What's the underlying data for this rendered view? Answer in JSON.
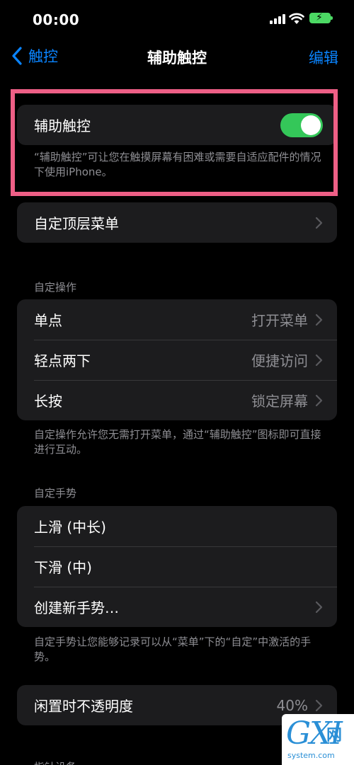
{
  "status_bar": {
    "time": "00:00"
  },
  "nav": {
    "back_label": "触控",
    "title": "辅助触控",
    "edit_label": "编辑"
  },
  "assistive_touch": {
    "label": "辅助触控",
    "enabled": true,
    "description": "“辅助触控”可让您在触摸屏幕有困难或需要自适应配件的情况下使用iPhone。"
  },
  "top_menu": {
    "label": "自定顶层菜单"
  },
  "custom_actions": {
    "header": "自定操作",
    "items": [
      {
        "label": "单点",
        "value": "打开菜单"
      },
      {
        "label": "轻点两下",
        "value": "便捷访问"
      },
      {
        "label": "长按",
        "value": "锁定屏幕"
      }
    ],
    "footer": "自定操作允许您无需打开菜单，通过“辅助触控”图标即可直接进行互动。"
  },
  "custom_gestures": {
    "header": "自定手势",
    "items": [
      {
        "label": "上滑 (中长)"
      },
      {
        "label": "下滑 (中)"
      },
      {
        "label": "创建新手势…"
      }
    ],
    "footer": "自定手势让您能够记录可以从“菜单”下的“自定”中激活的手势。"
  },
  "idle_opacity": {
    "label": "闲置时不透明度",
    "value": "40%"
  },
  "next_section_header": "指针设备",
  "watermark": {
    "logo": "GXI",
    "cn": "网",
    "domain": "system.com"
  },
  "colors": {
    "accent": "#0a84ff",
    "toggle_on": "#34c759",
    "highlight": "#ee5f86",
    "cell_bg": "#1c1c1e"
  }
}
